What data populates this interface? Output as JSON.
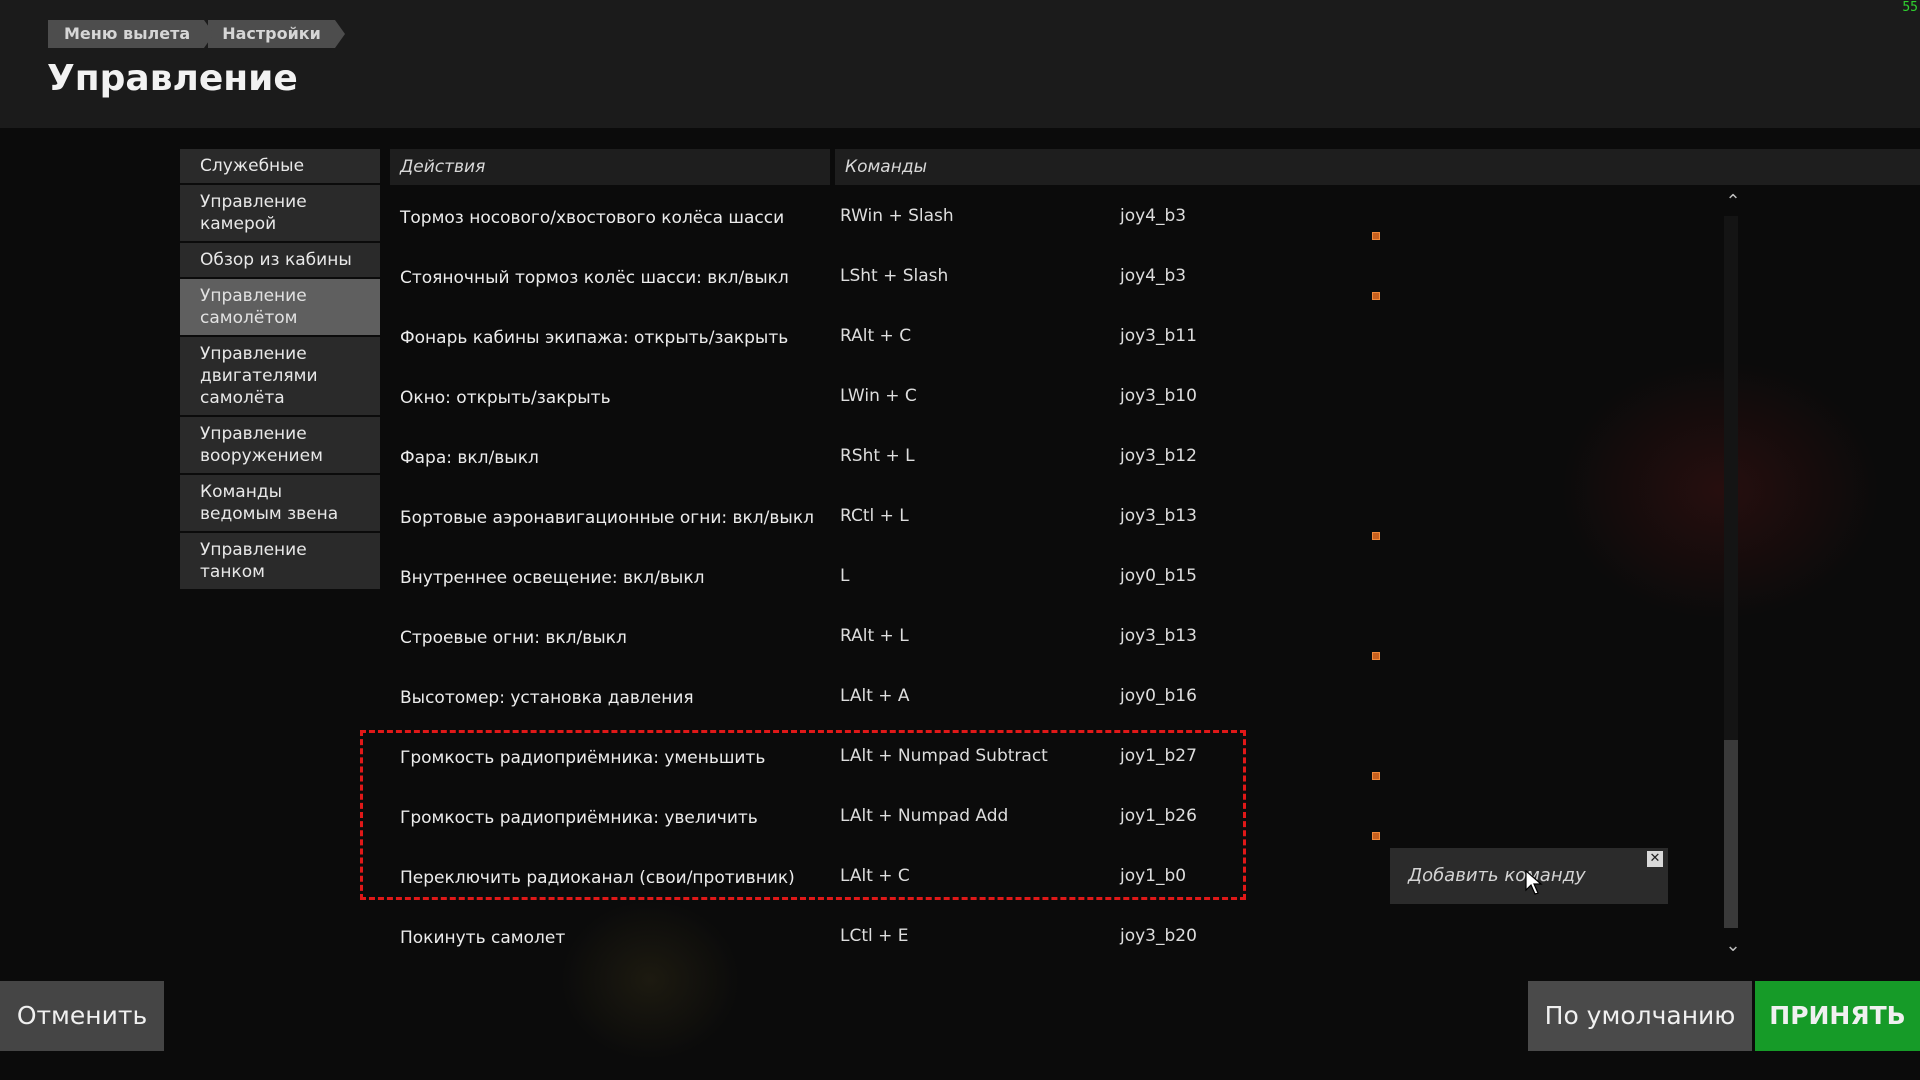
{
  "fps": "55",
  "breadcrumb": [
    "Меню вылета",
    "Настройки"
  ],
  "page_title": "Управление",
  "sidebar": [
    {
      "label": "Служебные",
      "active": false
    },
    {
      "label": "Управление камерой",
      "active": false
    },
    {
      "label": "Обзор из кабины",
      "active": false
    },
    {
      "label": "Управление самолётом",
      "active": true
    },
    {
      "label": "Управление двигателями самолёта",
      "active": false
    },
    {
      "label": "Управление вооружением",
      "active": false
    },
    {
      "label": "Команды ведомым звена",
      "active": false
    },
    {
      "label": "Управление танком",
      "active": false
    }
  ],
  "columns": {
    "actions": "Действия",
    "commands": "Команды"
  },
  "rows": [
    {
      "action": "Тормоз носового/хвостового колёса шасси",
      "key": "RWin + Slash",
      "joy": "joy4_b3",
      "marker": true
    },
    {
      "action": "Стояночный тормоз колёс шасси: вкл/выкл",
      "key": "LSht + Slash",
      "joy": "joy4_b3",
      "marker": true
    },
    {
      "action": "Фонарь кабины экипажа: открыть/закрыть",
      "key": "RAlt + C",
      "joy": "joy3_b11",
      "marker": false
    },
    {
      "action": "Окно: открыть/закрыть",
      "key": "LWin + C",
      "joy": "joy3_b10",
      "marker": false
    },
    {
      "action": "Фара: вкл/выкл",
      "key": "RSht + L",
      "joy": "joy3_b12",
      "marker": false
    },
    {
      "action": "Бортовые аэронавигационные огни: вкл/выкл",
      "key": "RCtl + L",
      "joy": "joy3_b13",
      "marker": true
    },
    {
      "action": "Внутреннее освещение: вкл/выкл",
      "key": "L",
      "joy": "joy0_b15",
      "marker": false
    },
    {
      "action": "Строевые огни: вкл/выкл",
      "key": "RAlt + L",
      "joy": "joy3_b13",
      "marker": true
    },
    {
      "action": "Высотомер: установка давления",
      "key": "LAlt + A",
      "joy": "joy0_b16",
      "marker": false
    },
    {
      "action": "Громкость радиоприёмника: уменьшить",
      "key": "LAlt + Numpad Subtract",
      "joy": "joy1_b27",
      "marker": true
    },
    {
      "action": "Громкость радиоприёмника: увеличить",
      "key": "LAlt + Numpad Add",
      "joy": "joy1_b26",
      "marker": true
    },
    {
      "action": "Переключить радиоканал (свои/противник)",
      "key": "LAlt + C",
      "joy": "joy1_b0",
      "marker": false
    },
    {
      "action": "Покинуть самолет",
      "key": "LCtl + E",
      "joy": "joy3_b20",
      "marker": false
    }
  ],
  "add_command": "Добавить команду",
  "buttons": {
    "cancel": "Отменить",
    "default": "По умолчанию",
    "accept": "ПРИНЯТЬ"
  },
  "colors": {
    "accept": "#169b28",
    "highlight": "#e01818",
    "marker": "#c8601e"
  }
}
